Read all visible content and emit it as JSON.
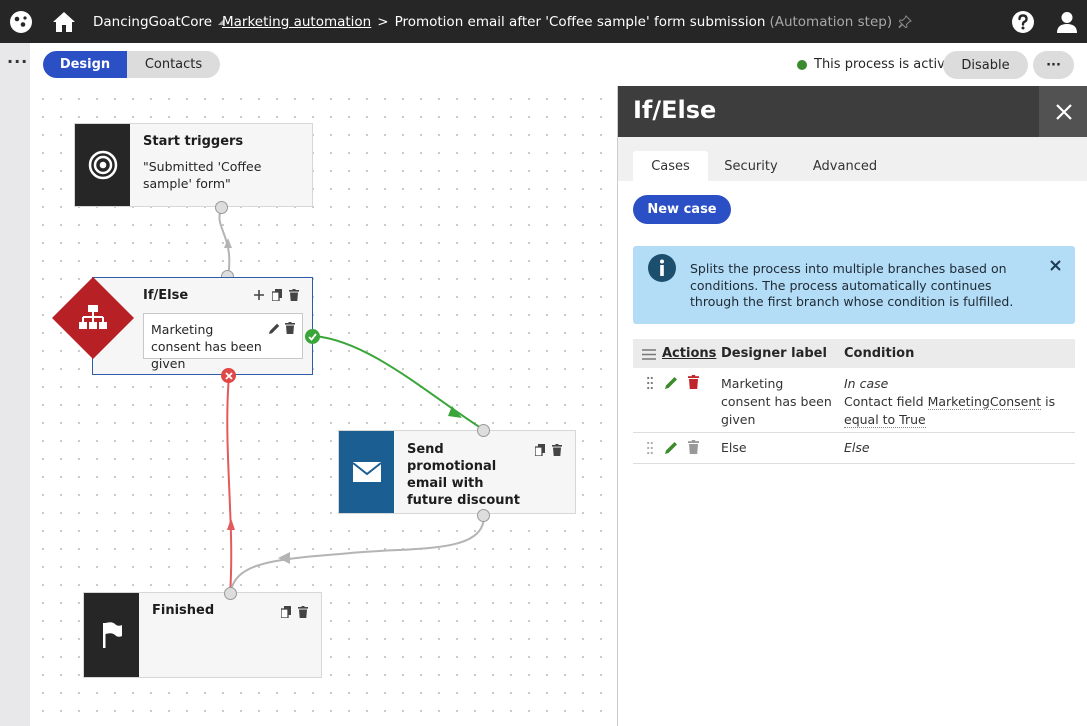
{
  "topbar": {
    "site_name": "DancingGoatCore",
    "breadcrumb_parent": "Marketing automation",
    "breadcrumb_separator": ">",
    "breadcrumb_current": "Promotion email after 'Coffee sample' form submission",
    "breadcrumb_type": "(Automation step)"
  },
  "toolbar": {
    "tabs": [
      {
        "label": "Design",
        "active": true
      },
      {
        "label": "Contacts",
        "active": false
      }
    ],
    "status_text": "This process is active",
    "status_color": "#3c8a2e",
    "disable_label": "Disable",
    "more_label": "···"
  },
  "gutter": {
    "more_label": "···"
  },
  "canvas": {
    "start_node": {
      "title": "Start triggers",
      "text": "\"Submitted 'Coffee sample' form\"",
      "icon": "target-icon"
    },
    "ifelse_node": {
      "title": "If/Else",
      "case_text": "Marketing consent has been given",
      "icon": "sitemap-icon",
      "color": "#b72025"
    },
    "email_node": {
      "title": "Send promotional email with future discount",
      "icon": "envelope-icon",
      "color": "#1b5e92"
    },
    "finished_node": {
      "title": "Finished",
      "icon": "flag-icon"
    }
  },
  "panel": {
    "title": "If/Else",
    "tabs": [
      "Cases",
      "Security",
      "Advanced"
    ],
    "active_tab": "Cases",
    "new_case_label": "New case",
    "info_text": "Splits the process into multiple branches based on conditions. The process automatically continues through the first branch whose condition is fulfilled.",
    "table": {
      "headers": [
        "Actions",
        "Designer label",
        "Condition"
      ],
      "rows": [
        {
          "label": "Marketing consent has been given",
          "condition_type": "In case",
          "condition_prefix": "Contact field ",
          "condition_field": "MarketingConsent",
          "condition_middle": " is",
          "condition_suffix": "equal to True"
        },
        {
          "label": "Else",
          "condition_type": "Else"
        }
      ]
    }
  }
}
